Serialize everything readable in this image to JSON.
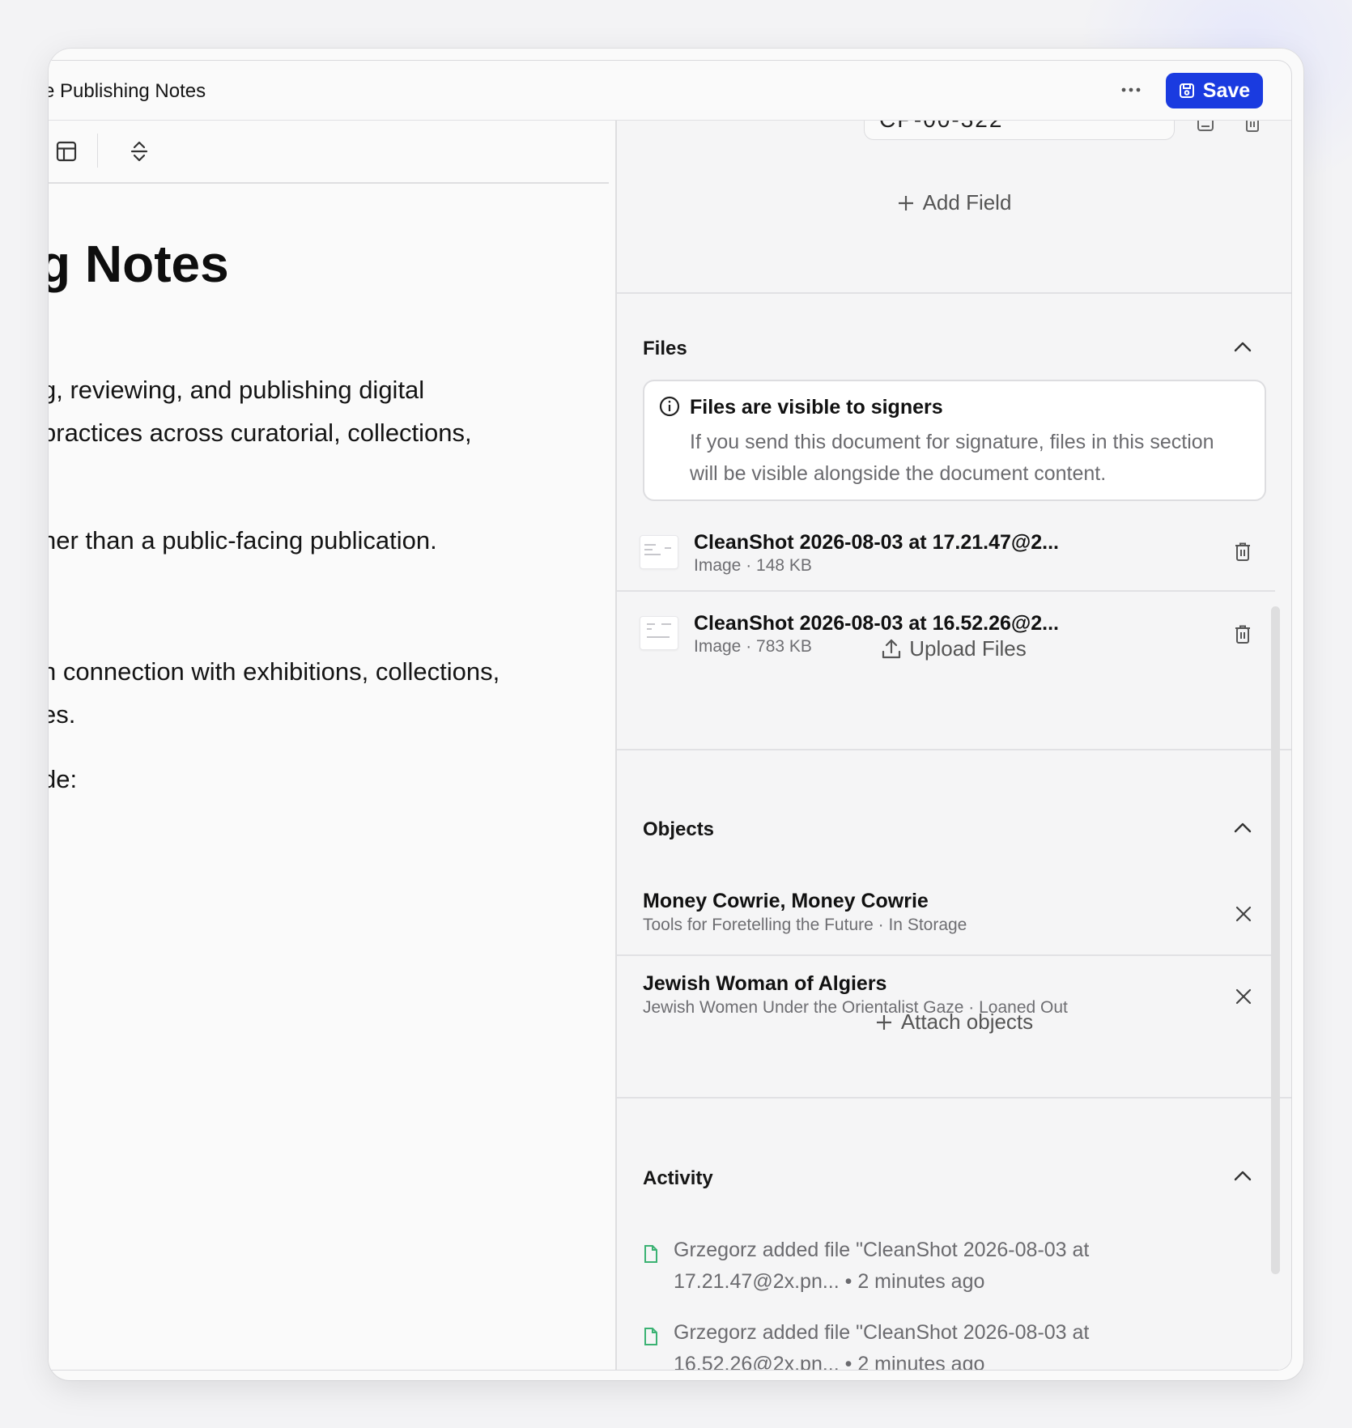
{
  "window": {
    "title": "e Publishing Notes",
    "save_label": "Save"
  },
  "editor": {
    "heading": "g Notes",
    "paragraphs": [
      "g, reviewing, and publishing digital",
      " practices across curatorial, collections,",
      "her than a public-facing publication.",
      "n connection with exhibitions, collections,",
      "es.",
      "de:"
    ]
  },
  "fields": {
    "partial_value": "CP-00-322",
    "add_field_label": "Add Field"
  },
  "files": {
    "title": "Files",
    "notice_title": "Files are visible to signers",
    "notice_body": "If you send this document for signature, files in this section will be visible alongside the document content.",
    "items": [
      {
        "name": "CleanShot 2026-08-03 at 17.21.47@2...",
        "meta": "Image · 148 KB"
      },
      {
        "name": "CleanShot 2026-08-03 at 16.52.26@2...",
        "meta": "Image · 783 KB"
      }
    ],
    "upload_label": "Upload Files"
  },
  "objects": {
    "title": "Objects",
    "items": [
      {
        "name": "Money Cowrie, Money Cowrie",
        "meta": "Tools for Foretelling the Future · In Storage"
      },
      {
        "name": "Jewish Woman of Algiers",
        "meta": "Jewish Women Under the Orientalist Gaze · Loaned Out"
      }
    ],
    "attach_label": "Attach objects"
  },
  "activity": {
    "title": "Activity",
    "items": [
      {
        "text": "Grzegorz added file \"CleanShot 2026-08-03 at 17.21.47@2x.pn... • 2 minutes ago"
      },
      {
        "text": "Grzegorz added file \"CleanShot 2026-08-03 at 16.52.26@2x.pn... • 2 minutes ago"
      }
    ]
  },
  "colors": {
    "accent": "#1a3be0",
    "activity_icon": "#3bb273"
  },
  "icons": [
    "more-icon",
    "save-icon",
    "table-icon",
    "collapse-icon",
    "edit-icon",
    "trash-icon",
    "plus-icon",
    "chevron-up-icon",
    "info-icon",
    "upload-icon",
    "close-icon",
    "file-icon"
  ]
}
